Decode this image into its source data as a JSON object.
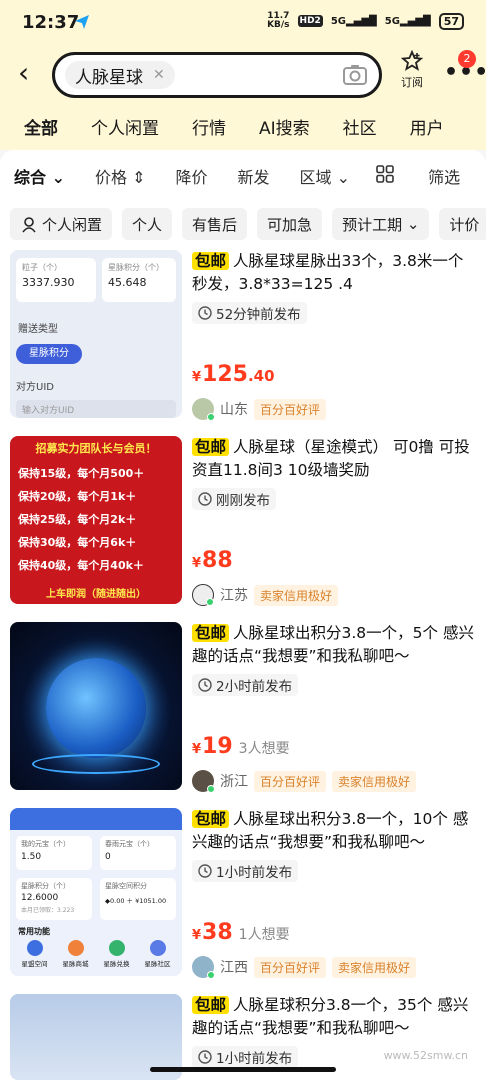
{
  "status": {
    "time": "12:37",
    "net_speed": "11.7",
    "net_unit": "KB/s",
    "hd": "HD2",
    "sig1": "5G",
    "sig2": "5G",
    "battery": "57"
  },
  "header": {
    "query": "人脉星球",
    "subscribe_label": "订阅",
    "badge_count": "2"
  },
  "categories": [
    "全部",
    "个人闲置",
    "行情",
    "AI搜索",
    "社区",
    "用户"
  ],
  "sort": {
    "combined": "综合",
    "price": "价格",
    "drop": "降价",
    "new": "新发",
    "region": "区域",
    "filter": "筛选"
  },
  "filters": [
    "个人闲置",
    "个人",
    "有售后",
    "可加急",
    "预计工期",
    "计价"
  ],
  "items": [
    {
      "free_ship": "包邮",
      "title": "人脉星球星脉出33个，3.8米一个秒发，3.8*33=125 .4",
      "posted": "52分钟前发布",
      "price_int": "125",
      "price_dec": ".40",
      "wants": "",
      "region": "山东",
      "badges": [
        "百分百好评"
      ],
      "thumb": {
        "label1": "粒子（个）",
        "value1": "3337.930",
        "label2": "星脉积分（个）",
        "value2": "45.648",
        "gift_type": "赠送类型",
        "pill": "星脉积分",
        "uid": "对方UID",
        "uid_input": "输入对方UID"
      }
    },
    {
      "free_ship": "包邮",
      "title": "人脉星球（星途模式） 可0撸 可投资直11.8间3 10级墙奖励",
      "posted": "刚刚发布",
      "price_int": "88",
      "price_dec": "",
      "wants": "",
      "region": "江苏",
      "badges": [
        "卖家信用极好"
      ],
      "thumb": {
        "headline": "招募实力团队长与会员！",
        "lines": [
          "保持15级，每个月500＋",
          "保持20级，每个月1k＋",
          "保持25级，每个月2k＋",
          "保持30级，每个月6k＋",
          "保持40级，每个月40k＋"
        ],
        "footer": "上车即润（随进随出）"
      }
    },
    {
      "free_ship": "包邮",
      "title": "人脉星球出积分3.8一个，5个 感兴趣的话点“我想要”和我私聊吧～",
      "posted": "2小时前发布",
      "price_int": "19",
      "price_dec": "",
      "wants": "3人想要",
      "region": "浙江",
      "badges": [
        "百分百好评",
        "卖家信用极好"
      ]
    },
    {
      "free_ship": "包邮",
      "title": "人脉星球出积分3.8一个，10个 感兴趣的话点“我想要”和我私聊吧～",
      "posted": "1小时前发布",
      "price_int": "38",
      "price_dec": "",
      "wants": "1人想要",
      "region": "江西",
      "badges": [
        "百分百好评",
        "卖家信用极好"
      ],
      "thumb": {
        "card1_label": "我的元宝（个）",
        "card1_value": "1.50",
        "card2_label": "春雨元宝（个）",
        "card2_value": "0",
        "card3_label": "星脉积分（个）",
        "card3_value": "12.6000",
        "card3_sub": "本月已领取：3.223",
        "card4_label": "星脉空间积分",
        "card4_value": "◆0.00 ＋ ¥1051.00",
        "section": "常用功能",
        "icons": [
          "星盟空间",
          "星脉商城",
          "星脉兑换",
          "星脉社区"
        ]
      }
    },
    {
      "free_ship": "包邮",
      "title": "人脉星球积分3.8一个，35个 感兴趣的话点“我想要”和我私聊吧～",
      "posted": "1小时前发布"
    }
  ],
  "watermark": "www.52smw.cn",
  "colors": {
    "accent": "#ffe000",
    "price": "#ff3b1e",
    "header_bg": "#fff8d6"
  }
}
